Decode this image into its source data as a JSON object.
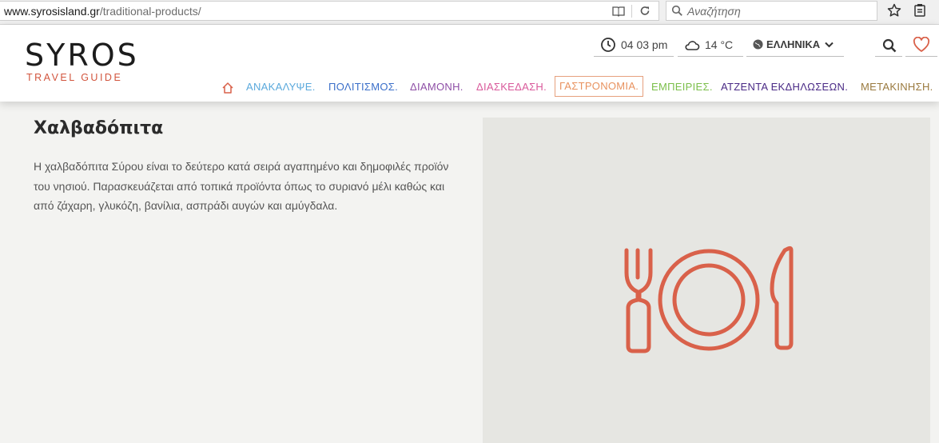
{
  "browser": {
    "url_host": "www.syrosisland.gr",
    "url_path": "/traditional-products/",
    "search_placeholder": "Αναζήτηση"
  },
  "header": {
    "logo_title": "SYROS",
    "logo_subtitle": "TRAVEL GUIDE",
    "time": "04 03 pm",
    "temperature": "14 °C",
    "language": "ΕΛΛΗΝΙΚΑ"
  },
  "nav": {
    "items": [
      {
        "label": "ΑΝΑΚΑΛΥΨΕ.",
        "color": "#5aa9dc"
      },
      {
        "label": "ΠΟΛΙΤΙΣΜΟΣ.",
        "color": "#3b6fc9"
      },
      {
        "label": "ΔΙΑΜΟΝΗ.",
        "color": "#8e4fa6"
      },
      {
        "label": "ΔΙΑΣΚΕΔΑΣΗ.",
        "color": "#d95a9b"
      },
      {
        "label": "ΓΑΣΤΡΟΝΟΜΙΑ.",
        "color": "#e8925f"
      },
      {
        "label": "ΕΜΠΕΙΡΙΕΣ.",
        "color": "#7bbf4a"
      },
      {
        "label": "ΑΤΖΕΝΤΑ ΕΚΔΗΛΩΣΕΩΝ.",
        "color": "#4a2a86"
      },
      {
        "label": "ΜΕΤΑΚΙΝΗΣΗ.",
        "color": "#9a7a3f"
      }
    ],
    "active_index": 4
  },
  "content": {
    "title": "Χαλβαδόπιτα",
    "description": "Η χαλβαδόπιτα Σύρου είναι το δεύτερο κατά σειρά αγαπημένο και δημοφιλές προϊόν του νησιού. Παρασκευάζεται από τοπικά προϊόντα όπως το συριανό μέλι καθώς και από ζάχαρη, γλυκόζη, βανίλια, ασπράδι αυγών και αμύγδαλα.",
    "image_icon": "fork-plate-knife-icon",
    "icon_color": "#d9614a"
  }
}
